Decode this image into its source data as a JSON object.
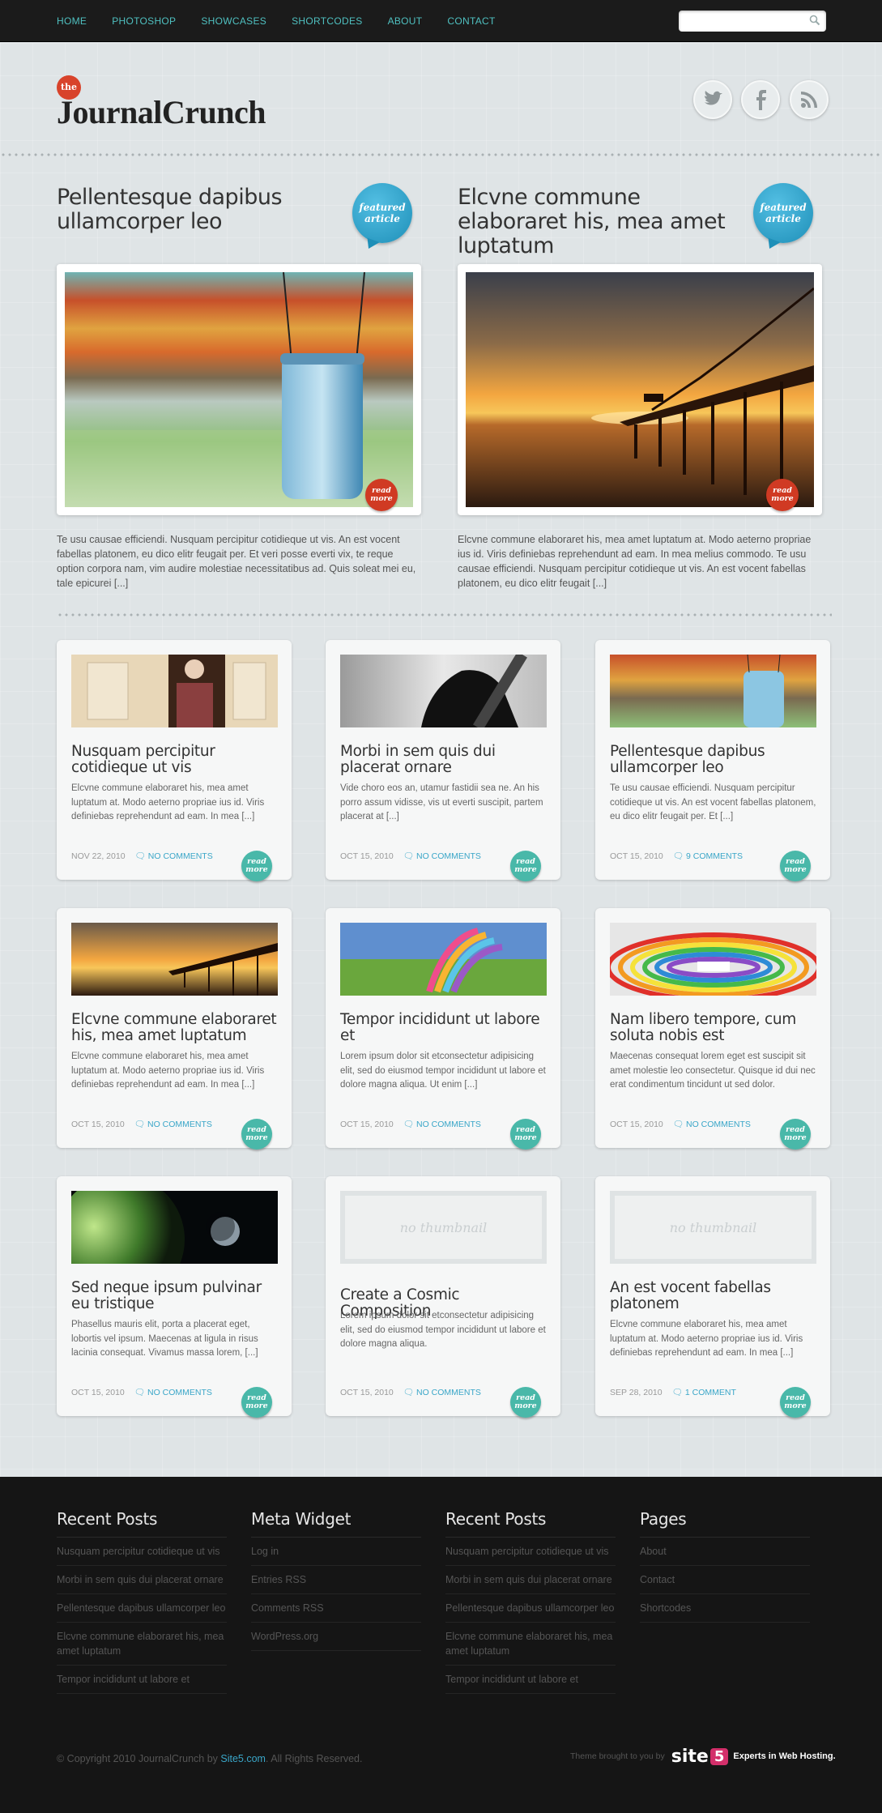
{
  "nav": {
    "items": [
      "HOME",
      "PHOTOSHOP",
      "SHOWCASES",
      "SHORTCODES",
      "ABOUT",
      "CONTACT"
    ],
    "search_placeholder": ""
  },
  "logo": {
    "small": "the",
    "name": "JournalCrunch"
  },
  "social": [
    "twitter-icon",
    "facebook-icon",
    "rss-icon"
  ],
  "featured": [
    {
      "title": "Pellentesque dapibus ullamcorper leo",
      "badge": "featured article",
      "readmore": "read more",
      "excerpt": "Te usu causae efficiendi. Nusquam percipitur cotidieque ut vis. An est vocent fabellas platonem, eu dico elitr feugait per. Et veri posse everti vix, te reque option corpora nam, vim audire molestiae necessitatibus ad. Quis soleat mei eu, tale epicurei [...]"
    },
    {
      "title": "Elcvne commune elaboraret his, mea amet luptatum",
      "badge": "featured article",
      "readmore": "read more",
      "excerpt": "Elcvne commune elaboraret his, mea amet luptatum at. Modo aeterno propriae ius id. Viris definiebas reprehendunt ad eam. In mea melius commodo. Te usu causae efficiendi. Nusquam percipitur cotidieque ut vis. An est vocent fabellas platonem, eu dico elitr feugait [...]"
    }
  ],
  "posts": [
    {
      "title": "Nusquam percipitur cotidieque ut vis",
      "excerpt": "Elcvne commune elaboraret his, mea amet luptatum at. Modo aeterno propriae ius id. Viris definiebas reprehendunt ad eam. In mea [...]",
      "date": "NOV 22, 2010",
      "comments": "NO COMMENTS",
      "readmore": "read more",
      "thumb": "kimono"
    },
    {
      "title": "Morbi in sem quis dui placerat ornare",
      "excerpt": "Vide choro eos an, utamur fastidii sea ne. An his porro assum vidisse, vis ut everti suscipit, partem placerat at [...]",
      "date": "OCT 15, 2010",
      "comments": "NO COMMENTS",
      "readmore": "read more",
      "thumb": "horse"
    },
    {
      "title": "Pellentesque dapibus ullamcorper leo",
      "excerpt": "Te usu causae efficiendi. Nusquam percipitur cotidieque ut vis. An est vocent fabellas platonem, eu dico elitr feugait per. Et [...]",
      "date": "OCT 15, 2010",
      "comments": "9 COMMENTS",
      "readmore": "read more",
      "thumb": "jar"
    },
    {
      "title": "Elcvne commune elaboraret his, mea amet luptatum",
      "excerpt": "Elcvne commune elaboraret his, mea amet luptatum at. Modo aeterno propriae ius id. Viris definiebas reprehendunt ad eam. In mea [...]",
      "date": "OCT 15, 2010",
      "comments": "NO COMMENTS",
      "readmore": "read more",
      "thumb": "pier"
    },
    {
      "title": "Tempor incididunt ut labore et",
      "excerpt": "Lorem ipsum dolor sit etconsectetur adipisicing elit, sed do eiusmod tempor incididunt ut labore et dolore magna aliqua. Ut enim [...]",
      "date": "OCT 15, 2010",
      "comments": "NO COMMENTS",
      "readmore": "read more",
      "thumb": "ribbons"
    },
    {
      "title": "Nam libero tempore, cum soluta nobis est",
      "excerpt": "Maecenas consequat lorem eget est suscipit sit amet molestie leo consectetur. Quisque id dui nec erat condimentum tincidunt ut sed dolor.",
      "date": "OCT 15, 2010",
      "comments": "NO COMMENTS",
      "readmore": "read more",
      "thumb": "rainbow"
    },
    {
      "title": "Sed neque ipsum pulvinar eu tristique",
      "excerpt": "Phasellus mauris elit, porta a placerat eget, lobortis vel ipsum. Maecenas at ligula in risus lacinia consequat. Vivamus massa lorem, [...]",
      "date": "OCT 15, 2010",
      "comments": "NO COMMENTS",
      "readmore": "read more",
      "thumb": "planet"
    },
    {
      "title": "Create a Cosmic Composition",
      "excerpt": "Lorem ipsum dolor sit etconsectetur adipisicing elit, sed do eiusmod tempor incididunt ut labore et dolore magna aliqua.",
      "date": "OCT 15, 2010",
      "comments": "NO COMMENTS",
      "readmore": "read more",
      "thumb": "none",
      "thumb_text": "no thumbnail"
    },
    {
      "title": "An est vocent fabellas platonem",
      "excerpt": "Elcvne commune elaboraret his, mea amet luptatum at. Modo aeterno propriae ius id. Viris definiebas reprehendunt ad eam. In mea [...]",
      "date": "SEP 28, 2010",
      "comments": "1 COMMENT",
      "readmore": "read more",
      "thumb": "none",
      "thumb_text": "no thumbnail"
    }
  ],
  "footer": {
    "columns": [
      {
        "title": "Recent Posts",
        "items": [
          "Nusquam percipitur cotidieque ut vis",
          "Morbi in sem quis dui placerat ornare",
          "Pellentesque dapibus ullamcorper leo",
          "Elcvne commune elaboraret his, mea amet luptatum",
          "Tempor incididunt ut labore et"
        ]
      },
      {
        "title": "Meta Widget",
        "items": [
          "Log in",
          "Entries RSS",
          "Comments RSS",
          "WordPress.org"
        ]
      },
      {
        "title": "Recent Posts",
        "items": [
          "Nusquam percipitur cotidieque ut vis",
          "Morbi in sem quis dui placerat ornare",
          "Pellentesque dapibus ullamcorper leo",
          "Elcvne commune elaboraret his, mea amet luptatum",
          "Tempor incididunt ut labore et"
        ]
      },
      {
        "title": "Pages",
        "items": [
          "About",
          "Contact",
          "Shortcodes"
        ]
      }
    ],
    "copyright_pre": "© Copyright 2010 JournalCrunch by",
    "copyright_link": "Site5.com",
    "copyright_post": ". All Rights Reserved.",
    "credit_text": "Theme brought to you by",
    "credit_brand": "site",
    "credit_num": "5",
    "credit_tagline": "Experts in Web Hosting."
  },
  "colors": {
    "accent": "#4fc0c0",
    "featured_badge": "#2a9fca",
    "readmore_red": "#d03a23",
    "readmore_teal": "#49b8a9",
    "link": "#3aa6c8"
  }
}
